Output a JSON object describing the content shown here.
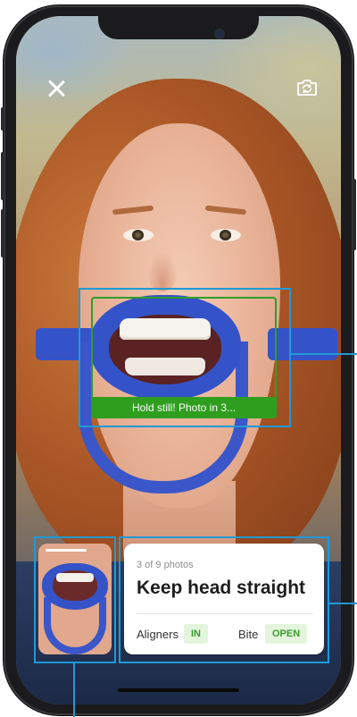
{
  "camera": {
    "close_icon": "close-icon",
    "flip_icon": "camera-flip-icon",
    "status_banner": "Hold still! Photo in 3..."
  },
  "photo_card": {
    "counter": "3 of 9 photos",
    "title": "Keep head straight",
    "aligners_label": "Aligners",
    "aligners_value": "IN",
    "bite_label": "Bite",
    "bite_value": "OPEN"
  },
  "colors": {
    "annotation": "#1f9ad6",
    "detect_frame": "#2e9e2c",
    "banner": "#2f9e1f",
    "badge_bg": "#e3f5dd",
    "badge_text": "#3a9c2e",
    "retractor": "#3553c8"
  }
}
